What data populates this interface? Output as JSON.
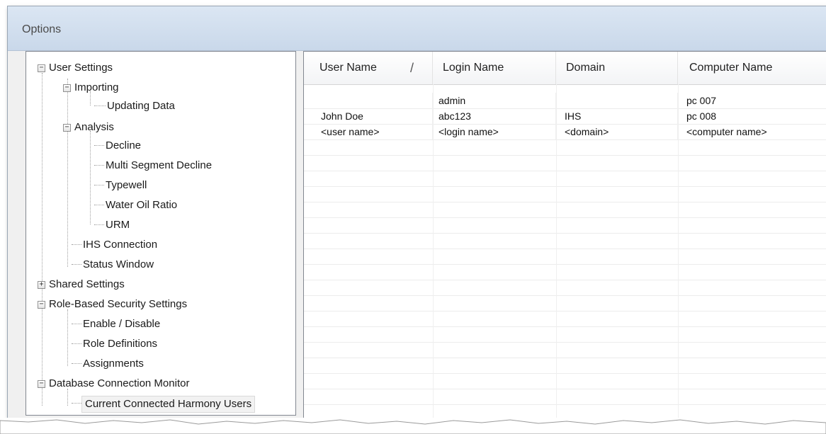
{
  "window": {
    "title": "Options"
  },
  "tree": {
    "user_settings": "User Settings",
    "importing": "Importing",
    "updating_data": "Updating Data",
    "analysis": "Analysis",
    "decline": "Decline",
    "multi_segment_decline": "Multi Segment Decline",
    "typewell": "Typewell",
    "water_oil_ratio": "Water Oil Ratio",
    "urm": "URM",
    "ihs_connection": "IHS Connection",
    "status_window": "Status Window",
    "shared_settings": "Shared Settings",
    "role_based_security": "Role-Based Security Settings",
    "enable_disable": "Enable / Disable",
    "role_definitions": "Role Definitions",
    "assignments": "Assignments",
    "db_connection_monitor": "Database Connection Monitor",
    "current_connected_users": "Current Connected Harmony Users",
    "expander_minus": "−",
    "expander_plus": "+"
  },
  "grid": {
    "columns": [
      "User Name",
      "Login Name",
      "Domain",
      "Computer Name"
    ],
    "sort_indicator": "/",
    "rows": [
      [
        "",
        "admin",
        "",
        "pc 007"
      ],
      [
        "John Doe",
        "abc123",
        "IHS",
        "pc 008"
      ],
      [
        "<user name>",
        "<login name>",
        "<domain>",
        "<computer name>"
      ]
    ]
  }
}
